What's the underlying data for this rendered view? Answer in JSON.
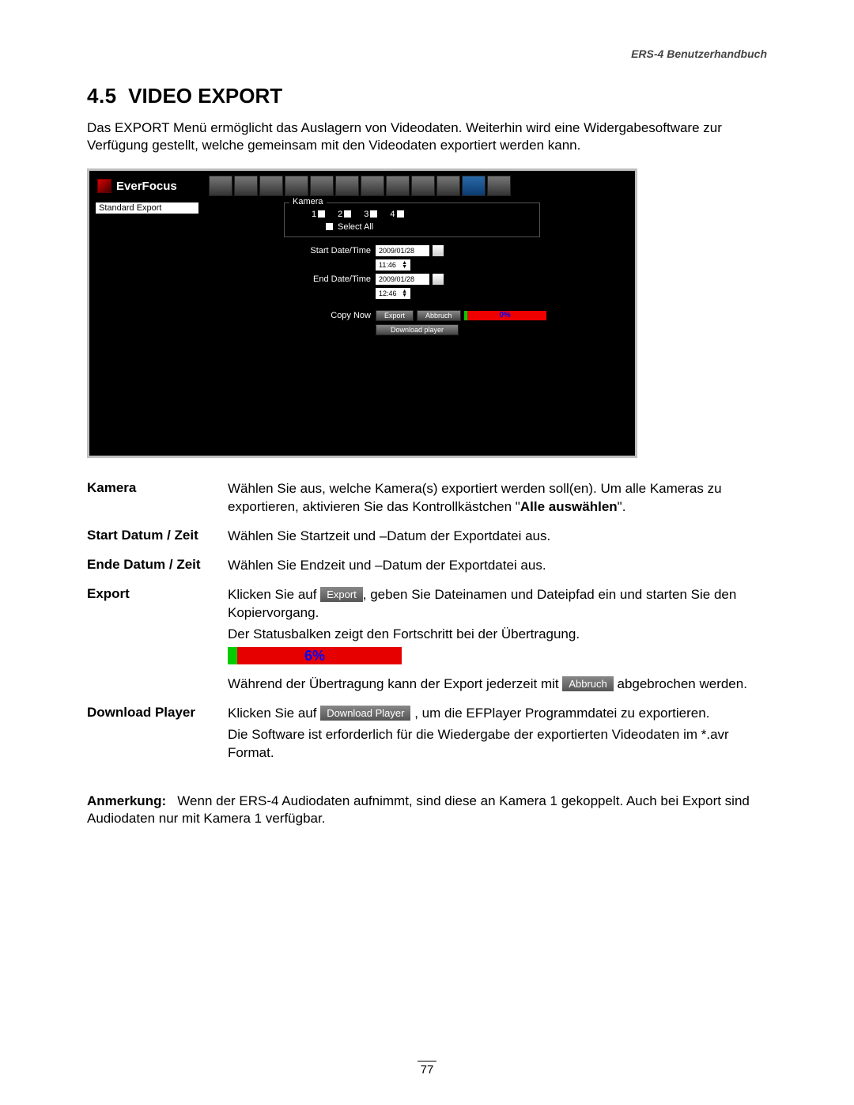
{
  "header": {
    "running": "ERS-4  Benutzerhandbuch"
  },
  "section": {
    "number": "4.5",
    "title": "VIDEO EXPORT"
  },
  "intro": "Das EXPORT Menü ermöglicht das Auslagern von Videodaten. Weiterhin wird eine Widergabesoftware zur Verfügung gestellt, welche gemeinsam mit den Videodaten exportiert werden kann.",
  "screenshot": {
    "brand": "EverFocus",
    "sidebar_item": "Standard Export",
    "fieldset_legend": "Kamera",
    "cams": [
      "1",
      "2",
      "3",
      "4"
    ],
    "select_all_label": "Select All",
    "start_label": "Start Date/Time",
    "end_label": "End Date/Time",
    "date_value": "2009/01/28",
    "start_time": "11:46",
    "end_time": "12:46",
    "copy_label": "Copy Now",
    "export_btn": "Export",
    "cancel_btn": "Abbruch",
    "progress_pct": "0%",
    "download_btn": "Download player"
  },
  "defs": {
    "kamera": {
      "label": "Kamera",
      "text1": "Wählen Sie aus, welche Kamera(s) exportiert werden soll(en). Um alle Kameras zu exportieren, aktivieren Sie das Kontrollkästchen \"",
      "bold": "Alle auswählen",
      "text2": "\"."
    },
    "start": {
      "label": "Start Datum / Zeit",
      "text": "Wählen Sie Startzeit und –Datum der Exportdatei aus."
    },
    "end": {
      "label": "Ende Datum / Zeit",
      "text": "Wählen Sie Endzeit und –Datum der Exportdatei aus."
    },
    "export": {
      "label": "Export",
      "pre": "Klicken Sie auf ",
      "btn": "Export",
      "post": ", geben Sie Dateinamen und Dateipfad ein und starten Sie den Kopiervorgang.",
      "status_line": "Der Statusbalken zeigt den Fortschritt bei der Übertragung.",
      "progress_pct": "6%",
      "during_pre": "Während der Übertragung kann der Export jederzeit mit ",
      "cancel_btn": "Abbruch",
      "during_post": " abgebrochen werden."
    },
    "download": {
      "label": "Download Player",
      "pre": "Klicken Sie auf ",
      "btn": "Download Player",
      "post": ", um die EFPlayer Programmdatei zu exportieren.",
      "note": "Die Software ist erforderlich für die Wiedergabe der exportierten Videodaten im *.avr Format."
    }
  },
  "remark": {
    "label": "Anmerkung:",
    "text": "Wenn der ERS-4 Audiodaten aufnimmt, sind diese an Kamera 1 gekoppelt. Auch bei Export sind Audiodaten nur mit Kamera 1 verfügbar."
  },
  "page_number": "77"
}
